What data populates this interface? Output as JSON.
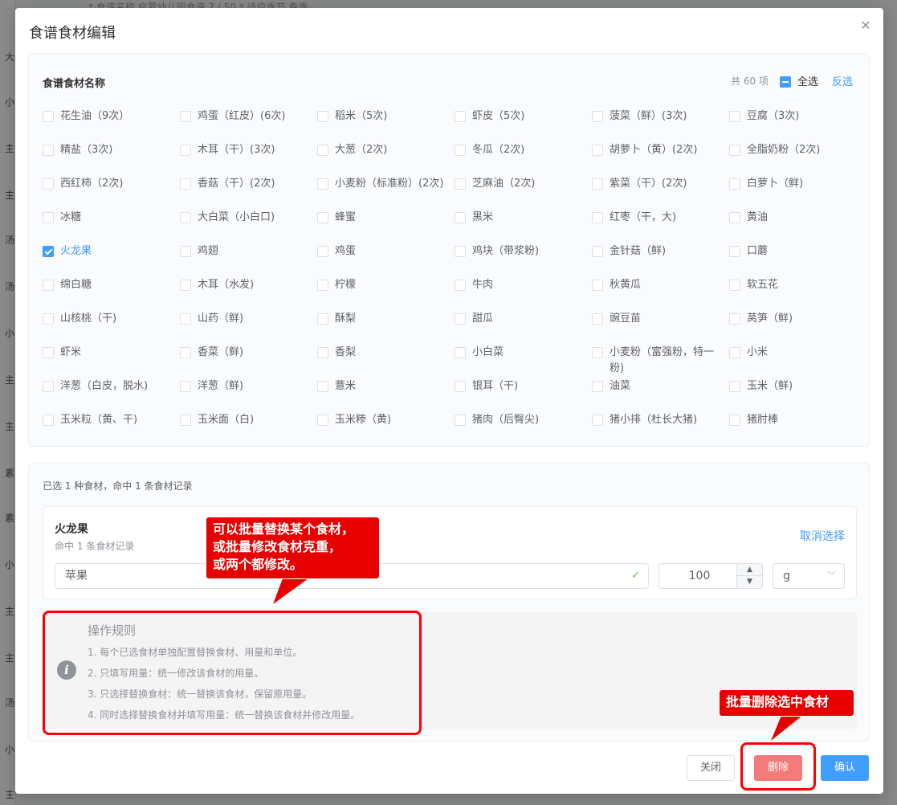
{
  "dialog": {
    "title": "食谱食材编辑",
    "close_icon": "close-icon"
  },
  "background": {
    "top_text": "* 食谱名称     启蒙幼儿园食谱                                 7 / 50          * 适应季节    春季",
    "left_chars": [
      "大",
      "小",
      "主",
      "主",
      "汤",
      "汤",
      "小",
      "主",
      "主",
      "素",
      "素",
      "小",
      "主",
      "主",
      "汤",
      "小",
      "主"
    ]
  },
  "ingredient_panel": {
    "title": "食谱食材名称",
    "count_text": "共 60 项",
    "select_all_label": "全选",
    "invert_label": "反选",
    "items": [
      {
        "label": "花生油（9次）",
        "checked": false
      },
      {
        "label": "鸡蛋（红皮）(6次)",
        "checked": false
      },
      {
        "label": "稻米（5次)",
        "checked": false
      },
      {
        "label": "虾皮（5次)",
        "checked": false
      },
      {
        "label": "菠菜（鲜）(3次)",
        "checked": false
      },
      {
        "label": "豆腐（3次)",
        "checked": false
      },
      {
        "label": "精盐（3次)",
        "checked": false
      },
      {
        "label": "木耳（干）(3次)",
        "checked": false
      },
      {
        "label": "大葱（2次)",
        "checked": false
      },
      {
        "label": "冬瓜（2次)",
        "checked": false
      },
      {
        "label": "胡萝卜（黄）(2次)",
        "checked": false
      },
      {
        "label": "全脂奶粉（2次)",
        "checked": false
      },
      {
        "label": "西红柿（2次)",
        "checked": false
      },
      {
        "label": "香菇（干）(2次)",
        "checked": false
      },
      {
        "label": "小麦粉（标准粉）(2次)",
        "checked": false
      },
      {
        "label": "芝麻油（2次)",
        "checked": false
      },
      {
        "label": "紫菜（干）(2次)",
        "checked": false
      },
      {
        "label": "白萝卜（鲜)",
        "checked": false
      },
      {
        "label": "冰糖",
        "checked": false
      },
      {
        "label": "大白菜（小白口)",
        "checked": false
      },
      {
        "label": "蜂蜜",
        "checked": false
      },
      {
        "label": "黑米",
        "checked": false
      },
      {
        "label": "红枣（干，大)",
        "checked": false
      },
      {
        "label": "黄油",
        "checked": false
      },
      {
        "label": "火龙果",
        "checked": true
      },
      {
        "label": "鸡翅",
        "checked": false
      },
      {
        "label": "鸡蛋",
        "checked": false
      },
      {
        "label": "鸡块（带浆粉)",
        "checked": false
      },
      {
        "label": "金针菇（鲜)",
        "checked": false
      },
      {
        "label": "口蘑",
        "checked": false
      },
      {
        "label": "绵白糖",
        "checked": false
      },
      {
        "label": "木耳（水发)",
        "checked": false
      },
      {
        "label": "柠檬",
        "checked": false
      },
      {
        "label": "牛肉",
        "checked": false
      },
      {
        "label": "秋黄瓜",
        "checked": false
      },
      {
        "label": "软五花",
        "checked": false
      },
      {
        "label": "山核桃（干)",
        "checked": false
      },
      {
        "label": "山药（鲜)",
        "checked": false
      },
      {
        "label": "酥梨",
        "checked": false
      },
      {
        "label": "甜瓜",
        "checked": false
      },
      {
        "label": "豌豆苗",
        "checked": false
      },
      {
        "label": "莴笋（鲜)",
        "checked": false
      },
      {
        "label": "虾米",
        "checked": false
      },
      {
        "label": "香菜（鲜)",
        "checked": false
      },
      {
        "label": "香梨",
        "checked": false
      },
      {
        "label": "小白菜",
        "checked": false
      },
      {
        "label": "小麦粉（富强粉，特一粉)",
        "checked": false
      },
      {
        "label": "小米",
        "checked": false
      },
      {
        "label": "洋葱（白皮，脱水)",
        "checked": false
      },
      {
        "label": "洋葱（鲜)",
        "checked": false
      },
      {
        "label": "薏米",
        "checked": false
      },
      {
        "label": "银耳（干)",
        "checked": false
      },
      {
        "label": "油菜",
        "checked": false
      },
      {
        "label": "玉米（鲜)",
        "checked": false
      },
      {
        "label": "玉米粒（黄、干)",
        "checked": false
      },
      {
        "label": "玉米面（白)",
        "checked": false
      },
      {
        "label": "玉米糁（黄)",
        "checked": false
      },
      {
        "label": "猪肉（后臀尖)",
        "checked": false
      },
      {
        "label": "猪小排（杜长大猪)",
        "checked": false
      },
      {
        "label": "猪肘棒",
        "checked": false
      }
    ]
  },
  "selection_panel": {
    "summary": "已选 1 种食材，命中 1 条食材记录",
    "card": {
      "name": "火龙果",
      "sub": "命中 1 条食材记录",
      "cancel_label": "取消选择",
      "replace_value": "苹果",
      "quantity": "100",
      "unit": "g"
    },
    "rules": {
      "title": "操作规则",
      "lines": [
        "1. 每个已选食材单独配置替换食材、用量和单位。",
        "2. 只填写用量：统一修改该食材的用量。",
        "3. 只选择替换食材：统一替换该食材，保留原用量。",
        "4. 同时选择替换食材并填写用量：统一替换该食材并修改用量。"
      ]
    }
  },
  "footer": {
    "close_label": "关闭",
    "delete_label": "删除",
    "confirm_label": "确认"
  },
  "annotations": {
    "replace_note_lines": [
      "可以批量替换某个食材，",
      "或批量修改食材克重，",
      "或两个都修改。"
    ],
    "delete_note": "批量删除选中食材"
  },
  "colors": {
    "primary": "#409eff",
    "danger": "#f56c6c",
    "annotation_red": "#e60000"
  }
}
